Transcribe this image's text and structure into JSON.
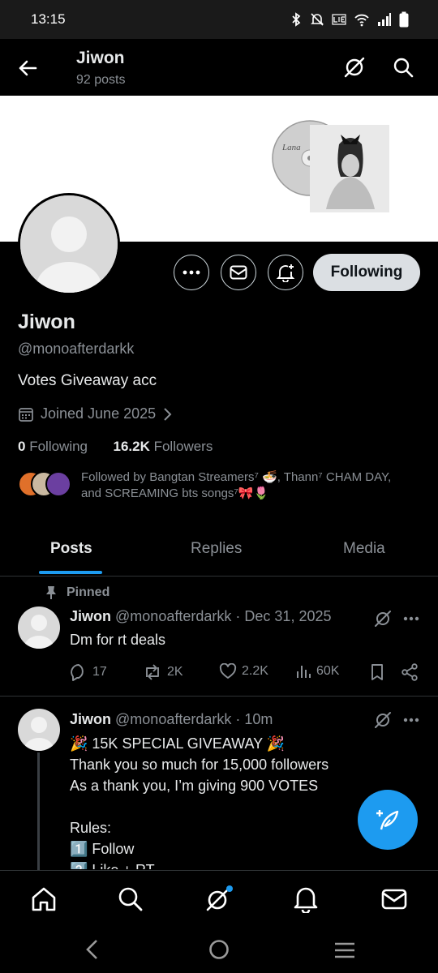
{
  "status_bar": {
    "time": "13:15"
  },
  "header": {
    "name": "Jiwon",
    "post_count": "92 posts"
  },
  "banner": {
    "album_text": "Lana"
  },
  "profile": {
    "display_name": "Jiwon",
    "handle": "@monoafterdarkk",
    "bio": "Votes Giveaway acc",
    "joined": "Joined June 2025",
    "following_count": "0",
    "following_label": "Following",
    "followers_count": "16.2K",
    "followers_label": "Followers",
    "followed_by": "Followed by Bangtan Streamers⁷ 🍜, Thann⁷ CHAM DAY, and SCREAMING bts songs⁷🎀🌷"
  },
  "buttons": {
    "following": "Following"
  },
  "tabs": [
    {
      "label": "Posts",
      "active": true
    },
    {
      "label": "Replies",
      "active": false
    },
    {
      "label": "Media",
      "active": false
    }
  ],
  "posts": [
    {
      "pinned_label": "Pinned",
      "name": "Jiwon",
      "handle": "@monoafterdarkk",
      "separator": "·",
      "time": "Dec 31, 2025",
      "text": "Dm for rt deals",
      "replies": "17",
      "reposts": "2K",
      "likes": "2.2K",
      "views": "60K"
    },
    {
      "name": "Jiwon",
      "handle": "@monoafterdarkk",
      "separator": "·",
      "time": "10m",
      "text": "🎉 15K SPECIAL GIVEAWAY 🎉\nThank you so much for 15,000 followers\nAs a thank you, I’m giving 900 VOTES\n\nRules:\n1️⃣ Follow\n2️⃣ Like + RT"
    }
  ],
  "colors": {
    "accent": "#1d9bf0",
    "background": "#000000",
    "muted": "#8b9096",
    "text": "#e7e9ea",
    "divider": "#2f3336"
  },
  "icons": [
    "back-arrow-icon",
    "grok-icon",
    "search-icon",
    "more-icon",
    "mail-icon",
    "bell-plus-icon",
    "calendar-icon",
    "pin-icon",
    "reply-icon",
    "repost-icon",
    "like-icon",
    "views-icon",
    "bookmark-icon",
    "share-icon",
    "compose-icon",
    "home-icon",
    "bell-icon"
  ]
}
